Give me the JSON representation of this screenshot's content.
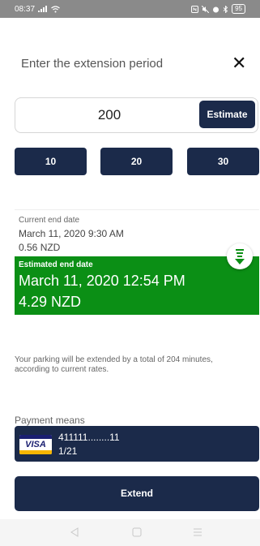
{
  "status_bar": {
    "time": "08:37",
    "battery": "95"
  },
  "header": {
    "title": "Enter the extension period",
    "close_icon": "close-icon"
  },
  "input": {
    "value": "200"
  },
  "estimate_button": "Estimate",
  "quick_options": [
    "10",
    "20",
    "30"
  ],
  "current": {
    "label": "Current end date",
    "date": "March 11, 2020 9:30 AM",
    "price": "0.56 NZD"
  },
  "estimated": {
    "label": "Estimated end date",
    "date": "March 11, 2020 12:54 PM",
    "price": "4.29 NZD"
  },
  "info_text": "Your parking will be extended by a total of 204 minutes, according to current rates.",
  "payment": {
    "label": "Payment means",
    "card_brand": "VISA",
    "card_number": "411111........11",
    "card_expiry": "1/21"
  },
  "extend_button": "Extend",
  "colors": {
    "primary": "#1b2a4a",
    "success": "#0b8f15"
  }
}
